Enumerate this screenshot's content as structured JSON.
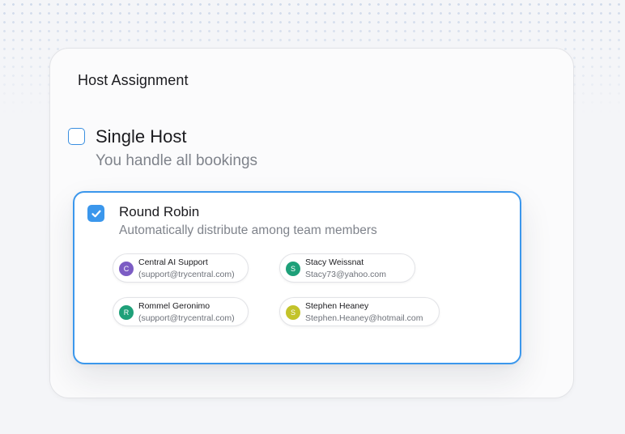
{
  "header": {
    "title": "Host Assignment"
  },
  "options": [
    {
      "title": "Single Host",
      "description": "You handle all bookings",
      "checked": false
    },
    {
      "title": "Round Robin",
      "description": "Automatically distribute among team members",
      "checked": true
    }
  ],
  "members": [
    {
      "initial": "C",
      "name": "Central AI Support",
      "email": "(support@trycentral.com)",
      "color": "#7c5cc4"
    },
    {
      "initial": "S",
      "name": "Stacy Weissnat",
      "email": "Stacy73@yahoo.com",
      "color": "#1ea079"
    },
    {
      "initial": "R",
      "name": "Rommel Geronimo",
      "email": "(support@trycentral.com)",
      "color": "#1ea079"
    },
    {
      "initial": "S",
      "name": "Stephen Heaney",
      "email": "Stephen.Heaney@hotmail.com",
      "color": "#c3c32a"
    }
  ],
  "colors": {
    "accent": "#3b97ec",
    "text": "#1b1b1f",
    "muted": "#7f838b"
  },
  "icons": {
    "checked": "checkmark-icon"
  }
}
